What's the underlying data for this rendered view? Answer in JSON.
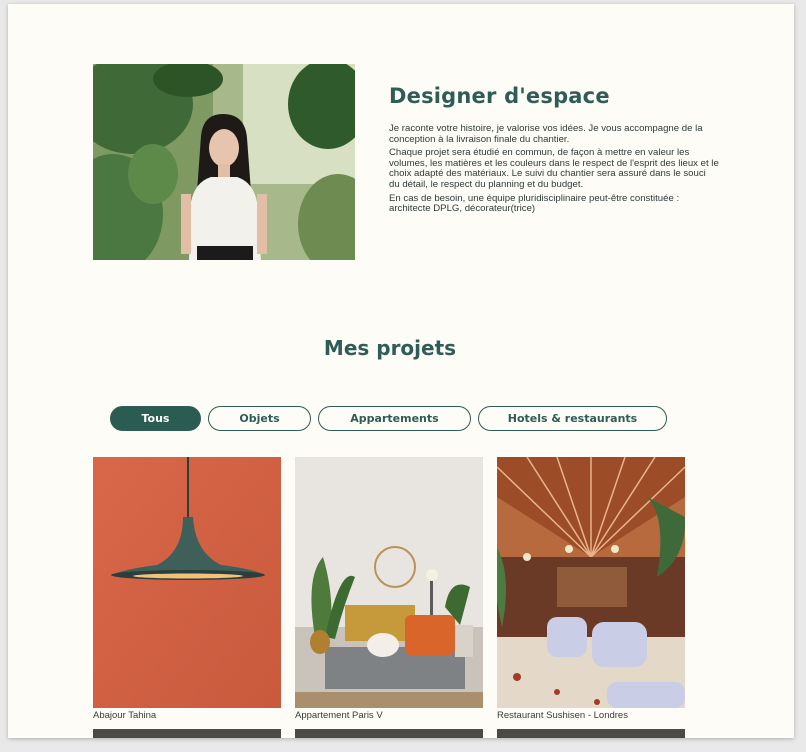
{
  "about": {
    "title": "Designer d'espace",
    "paragraphs": [
      "Je raconte votre histoire, je valorise vos idées. Je vous accompagne de la conception à la livraison finale du chantier.",
      "Chaque projet sera étudié en commun, de façon à mettre en valeur les volumes, les matières et les couleurs dans le respect de l'esprit des lieux et le choix adapté des matériaux. Le suivi du chantier sera assuré dans le souci du détail, le respect du planning et du budget.",
      "En cas de besoin, une équipe pluridisciplinaire peut-être constituée : architecte DPLG, décorateur(trice)"
    ]
  },
  "projects": {
    "title": "Mes projets",
    "filters": [
      {
        "label": "Tous",
        "active": true
      },
      {
        "label": "Objets",
        "active": false
      },
      {
        "label": "Appartements",
        "active": false
      },
      {
        "label": "Hotels & restaurants",
        "active": false
      }
    ],
    "items": [
      {
        "caption": "Abajour Tahina"
      },
      {
        "caption": "Appartement Paris V"
      },
      {
        "caption": "Restaurant Sushisen - Londres"
      }
    ]
  },
  "colors": {
    "accent": "#2f5d56",
    "background": "#fdfcf6"
  }
}
